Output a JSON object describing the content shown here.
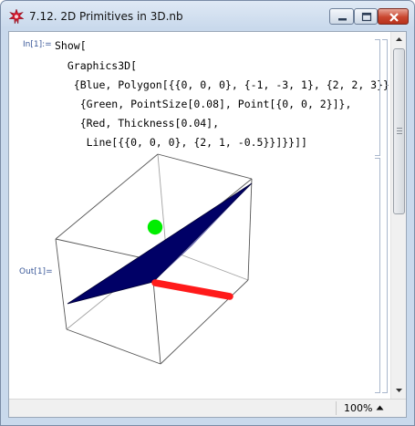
{
  "window": {
    "title": "7.12. 2D Primitives in 3D.nb",
    "icon": "mathematica-star-icon",
    "controls": [
      "minimize-icon",
      "maximize-icon",
      "close-icon"
    ]
  },
  "notebook": {
    "input_label": "In[1]:=",
    "output_label": "Out[1]=",
    "input_code": [
      "Show[",
      "  Graphics3D[",
      "   {Blue, Polygon[{{0, 0, 0}, {-1, -3, 1}, {2, 2, 3}}],",
      "    {Green, PointSize[0.08], Point[{0, 0, 2}]},",
      "    {Red, Thickness[0.04],",
      "     Line[{{0, 0, 0}, {2, 1, -0.5}}]}}]]"
    ],
    "output_graphic": {
      "polygon_color": "#000066",
      "point_color": "#00ee00",
      "line_color": "#ff0000",
      "box_color": "#555555"
    }
  },
  "status": {
    "zoom": "100%"
  },
  "colors": {
    "label_blue": "#3c5a9a",
    "bracket": "#a9b7cc"
  }
}
